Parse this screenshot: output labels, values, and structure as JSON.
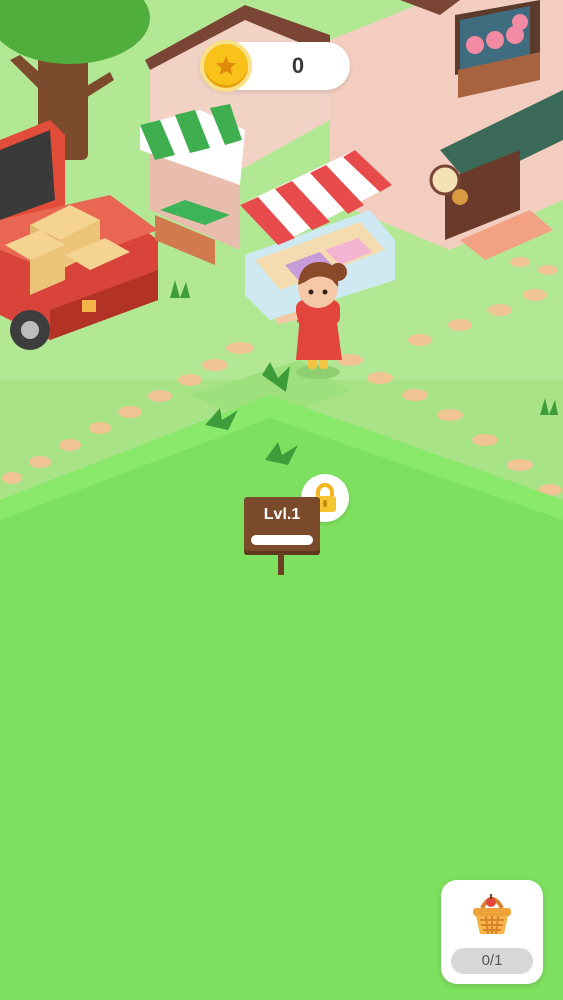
{
  "hud": {
    "coins": "0",
    "coin_icon": "star-coin-icon"
  },
  "field": {
    "level_label": "Lvl.1",
    "level_progress": 0,
    "locked": true,
    "lock_icon": "padlock-icon"
  },
  "inventory": {
    "basket_icon": "basket-icon",
    "count": "0/1"
  },
  "colors": {
    "grass": "#7ee05f",
    "ground": "#a8e388",
    "sign": "#7b4a2b",
    "coin": "#f9c21a",
    "awning_red": "#e84b4b"
  }
}
